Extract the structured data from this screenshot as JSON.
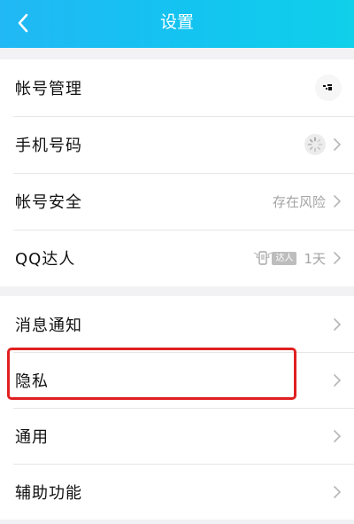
{
  "header": {
    "title": "设置"
  },
  "groups": [
    {
      "items": [
        {
          "label": "帐号管理"
        },
        {
          "label": "手机号码"
        },
        {
          "label": "帐号安全",
          "value": "存在风险"
        },
        {
          "label": "QQ达人",
          "badge": "达人",
          "value": "1天"
        }
      ]
    },
    {
      "items": [
        {
          "label": "消息通知"
        },
        {
          "label": "隐私"
        },
        {
          "label": "通用"
        },
        {
          "label": "辅助功能"
        }
      ]
    }
  ],
  "highlight": {
    "color": "#e02020",
    "target": "隐私"
  },
  "colors": {
    "header_start": "#21b8f5",
    "header_end": "#10d0ea",
    "background": "#f2f2f5",
    "secondary_text": "#a3a3a3"
  }
}
